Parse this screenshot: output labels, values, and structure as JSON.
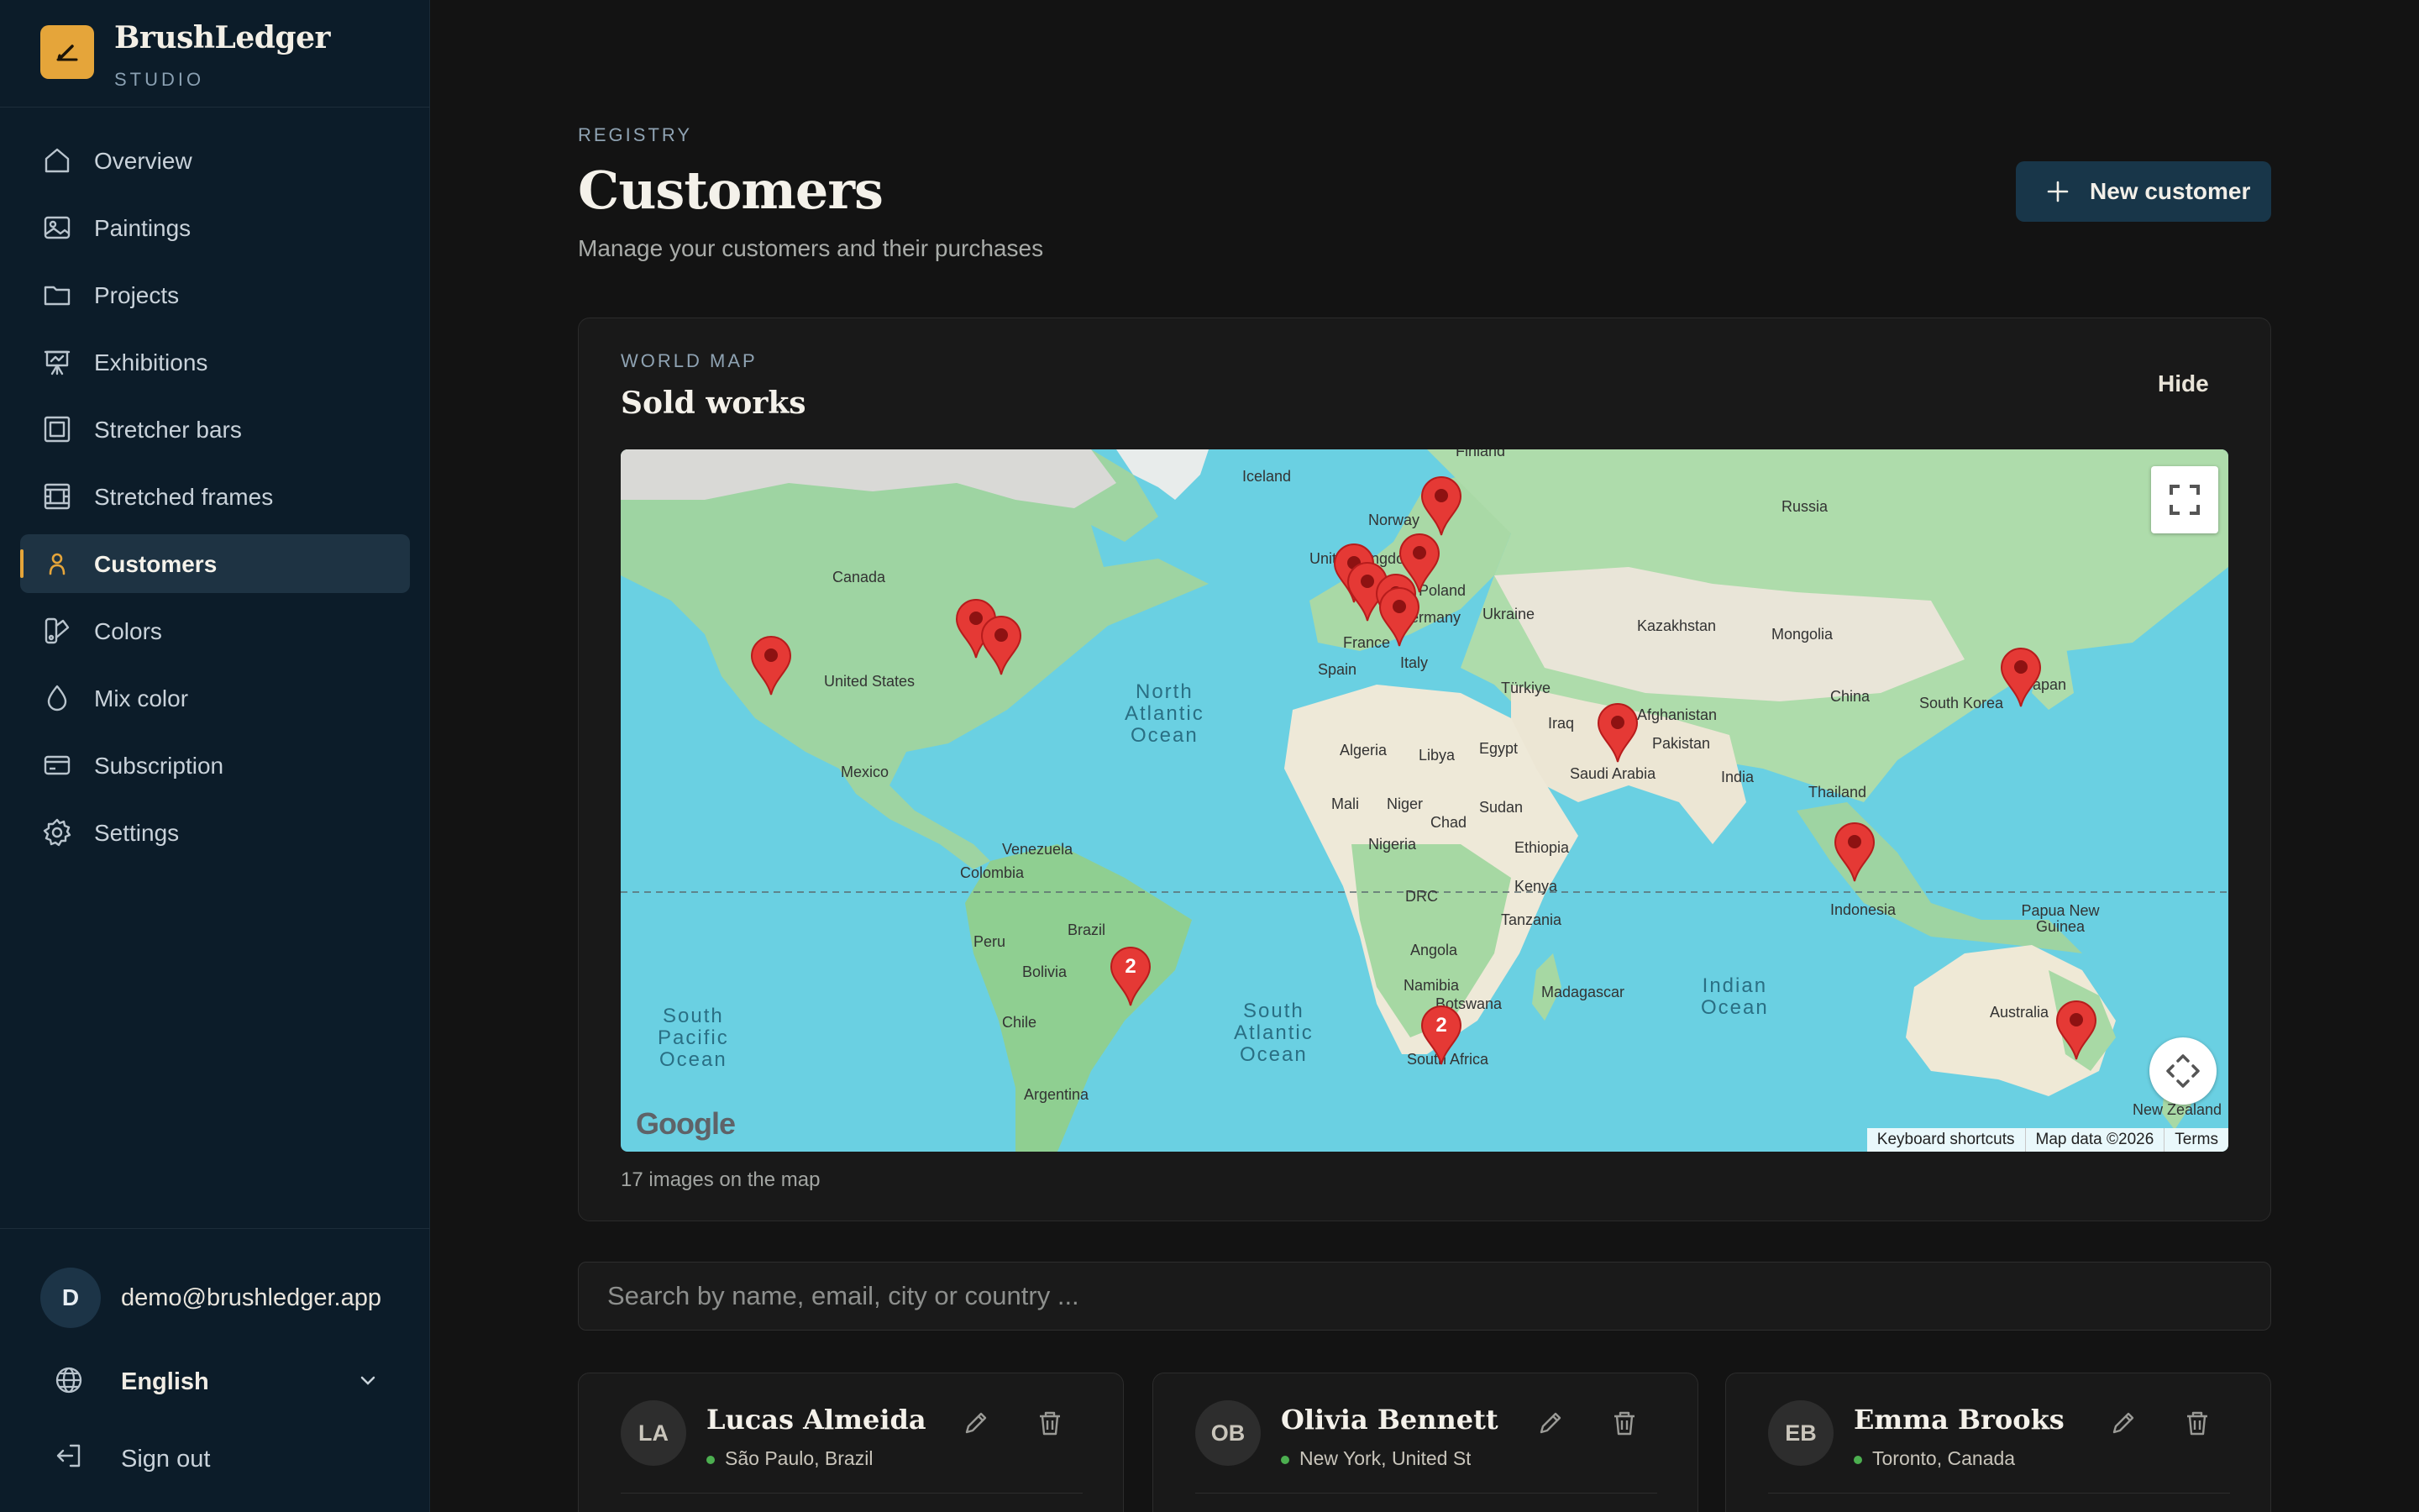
{
  "brand": {
    "name": "BrushLedger",
    "sub": "STUDIO"
  },
  "colors": {
    "accent": "#e5a53a",
    "sidebar": "#0c1c29",
    "primary_button": "#183649",
    "marker": "#e53935"
  },
  "nav": {
    "items": [
      {
        "label": "Overview",
        "icon": "home-icon"
      },
      {
        "label": "Paintings",
        "icon": "image-icon"
      },
      {
        "label": "Projects",
        "icon": "folder-icon"
      },
      {
        "label": "Exhibitions",
        "icon": "easel-icon"
      },
      {
        "label": "Stretcher bars",
        "icon": "frame-icon"
      },
      {
        "label": "Stretched frames",
        "icon": "film-frame-icon"
      },
      {
        "label": "Customers",
        "icon": "user-icon",
        "active": true
      },
      {
        "label": "Colors",
        "icon": "swatch-icon"
      },
      {
        "label": "Mix color",
        "icon": "droplet-icon"
      },
      {
        "label": "Subscription",
        "icon": "card-icon"
      },
      {
        "label": "Settings",
        "icon": "gear-icon"
      }
    ]
  },
  "user": {
    "initial": "D",
    "email": "demo@brushledger.app"
  },
  "language": {
    "selected": "English"
  },
  "signout": {
    "label": "Sign out"
  },
  "page": {
    "eyebrow": "REGISTRY",
    "title": "Customers",
    "subtitle": "Manage your customers and their purchases",
    "new_button": "New customer"
  },
  "map": {
    "eyebrow": "WORLD MAP",
    "title": "Sold works",
    "hide": "Hide",
    "count_text": "17 images on the map",
    "google": "Google",
    "attribution": [
      "Keyboard shortcuts",
      "Map data ©2026",
      "Terms"
    ],
    "clusters": [
      "2",
      "2"
    ],
    "labels": [
      "Iceland",
      "Norway",
      "Finland",
      "Russia",
      "Canada",
      "United States",
      "Mexico",
      "United Kingdom",
      "Poland",
      "Germany",
      "France",
      "Spain",
      "Italy",
      "Ukraine",
      "Türkiye",
      "Kazakhstan",
      "Mongolia",
      "China",
      "South Korea",
      "Japan",
      "Afghanistan",
      "Pakistan",
      "Iraq",
      "Saudi Arabia",
      "India",
      "Thailand",
      "Algeria",
      "Libya",
      "Egypt",
      "Mali",
      "Niger",
      "Chad",
      "Sudan",
      "Nigeria",
      "Ethiopia",
      "Kenya",
      "DRC",
      "Tanzania",
      "Angola",
      "Namibia",
      "Botswana",
      "South Africa",
      "Madagascar",
      "Venezuela",
      "Colombia",
      "Peru",
      "Brazil",
      "Bolivia",
      "Chile",
      "Argentina",
      "Indonesia",
      "Papua New Guinea",
      "Australia",
      "New Zealand"
    ],
    "oceans": [
      "North\nAtlantic\nOcean",
      "South\nAtlantic\nOcean",
      "South\nPacific\nOcean",
      "Indian\nOcean"
    ]
  },
  "search": {
    "placeholder": "Search by name, email, city or country ..."
  },
  "customers": [
    {
      "initials": "LA",
      "name": "Lucas Almeida",
      "location": "São Paulo, Brazil"
    },
    {
      "initials": "OB",
      "name": "Olivia Bennett",
      "location": "New York, United States"
    },
    {
      "initials": "EB",
      "name": "Emma Brooks",
      "location": "Toronto, Canada"
    }
  ]
}
